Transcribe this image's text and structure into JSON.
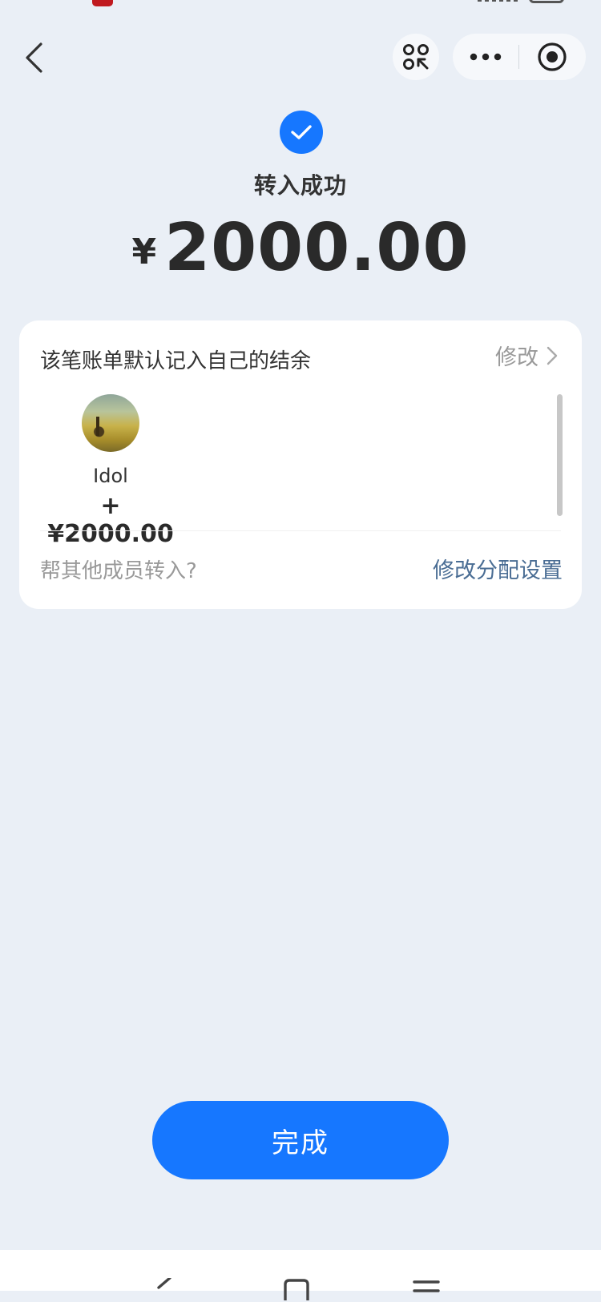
{
  "nav": {
    "back_icon": "chevron-left-icon",
    "scan_icon": "scan-icon",
    "more_icon": "more-horizontal-icon",
    "close_icon": "target-circle-icon"
  },
  "result": {
    "status": "转入成功",
    "currency": "¥",
    "amount": "2000.00",
    "accent": "#1677ff"
  },
  "card": {
    "note": "该笔账单默认记入自己的结余",
    "edit_label": "修改",
    "members": [
      {
        "name": "Idol",
        "delta": "+¥2000.00"
      }
    ],
    "help_text": "帮其他成员转入?",
    "allocation_link": "修改分配设置",
    "link_color": "#4a6d94"
  },
  "actions": {
    "done_label": "完成"
  }
}
